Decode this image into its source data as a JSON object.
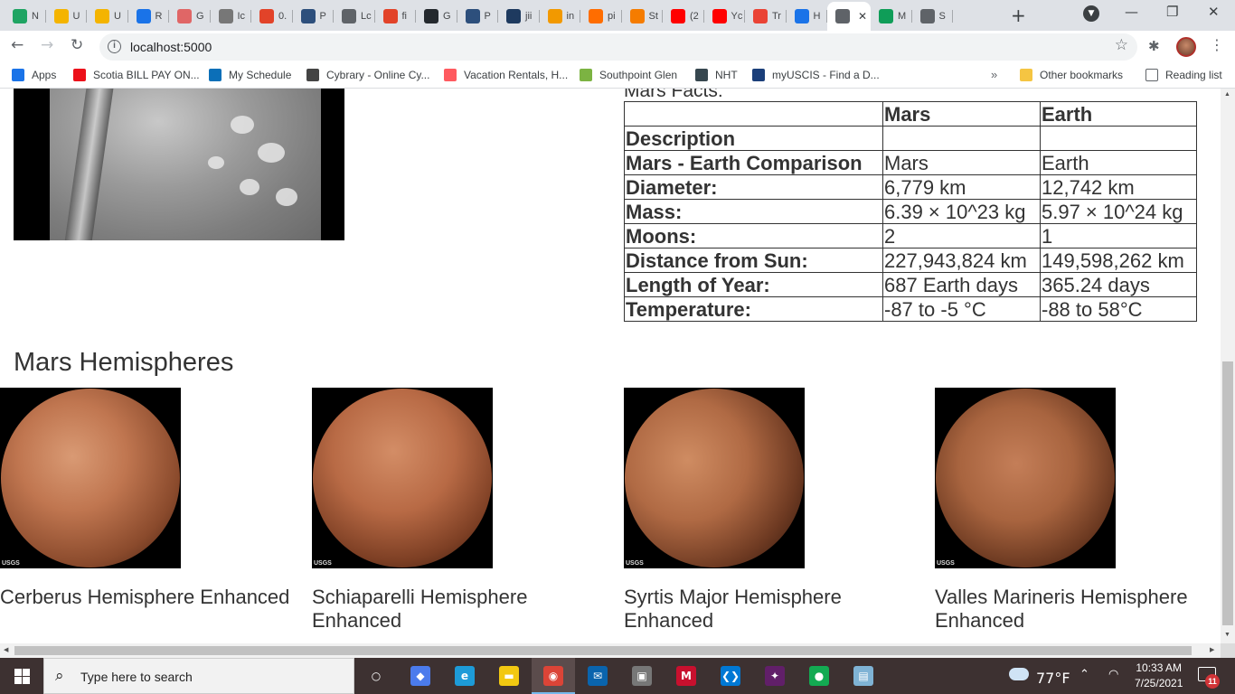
{
  "browser": {
    "tabs": [
      {
        "label": "N",
        "icon": "google-drive-icon",
        "color": "#1fa463"
      },
      {
        "label": "U",
        "icon": "slides-icon",
        "color": "#f4b400"
      },
      {
        "label": "U",
        "icon": "slides-icon",
        "color": "#f4b400"
      },
      {
        "label": "R",
        "icon": "video-icon",
        "color": "#1a73e8"
      },
      {
        "label": "G",
        "icon": "network-icon",
        "color": "#e06666"
      },
      {
        "label": "Ic",
        "icon": "doc-icon",
        "color": "#777777"
      },
      {
        "label": "0.",
        "icon": "gitlab-icon",
        "color": "#e24329"
      },
      {
        "label": "P",
        "icon": "tds-icon",
        "color": "#2d4f7c"
      },
      {
        "label": "Lc",
        "icon": "globe-icon",
        "color": "#5f6368"
      },
      {
        "label": "fi",
        "icon": "gitlab-icon",
        "color": "#e24329"
      },
      {
        "label": "G",
        "icon": "github-icon",
        "color": "#24292e"
      },
      {
        "label": "P",
        "icon": "tds-icon",
        "color": "#2d4f7c"
      },
      {
        "label": "jii",
        "icon": "terminal-icon",
        "color": "#1e3a5f"
      },
      {
        "label": "in",
        "icon": "chart-icon",
        "color": "#f29900"
      },
      {
        "label": "pi",
        "icon": "codepen-icon",
        "color": "#ff6d00"
      },
      {
        "label": "St",
        "icon": "book-icon",
        "color": "#f57c00"
      },
      {
        "label": "(2",
        "icon": "youtube-icon",
        "color": "#ff0000"
      },
      {
        "label": "Yc",
        "icon": "youtube-icon",
        "color": "#ff0000"
      },
      {
        "label": "Tr",
        "icon": "gmail-icon",
        "color": "#ea4335"
      },
      {
        "label": "H",
        "icon": "info-icon",
        "color": "#1a73e8"
      },
      {
        "label": "",
        "icon": "globe-icon",
        "color": "#5f6368",
        "active": true
      },
      {
        "label": "M",
        "icon": "plus-tile-icon",
        "color": "#0f9d58"
      },
      {
        "label": "S",
        "icon": "globe-icon",
        "color": "#5f6368"
      }
    ],
    "new_tab_glyph": "+",
    "url": "localhost:5000",
    "bookmarks": [
      {
        "label": "Apps",
        "icon": "apps-grid-icon",
        "color": "#1a73e8"
      },
      {
        "label": "Scotia BILL PAY ON...",
        "icon": "scotia-icon",
        "color": "#ec111a"
      },
      {
        "label": "My Schedule",
        "icon": "schedule-icon",
        "color": "#0b6fb8"
      },
      {
        "label": "Cybrary - Online Cy...",
        "icon": "cybrary-icon",
        "color": "#444444"
      },
      {
        "label": "Vacation Rentals, H...",
        "icon": "airbnb-icon",
        "color": "#ff5a5f"
      },
      {
        "label": "Southpoint Glen",
        "icon": "building-icon",
        "color": "#7cb342"
      },
      {
        "label": "NHT",
        "icon": "nht-icon",
        "color": "#37474f"
      },
      {
        "label": "myUSCIS - Find a D...",
        "icon": "uscis-icon",
        "color": "#1b3f7a"
      }
    ],
    "more_bookmarks_glyph": "»",
    "other_bookmarks": "Other bookmarks",
    "reading_list": "Reading list"
  },
  "page": {
    "facts_heading": "Mars Facts:",
    "table": {
      "headers": [
        "",
        "Mars",
        "Earth"
      ],
      "rows": [
        [
          "Description",
          "",
          ""
        ],
        [
          "Mars - Earth Comparison",
          "Mars",
          "Earth"
        ],
        [
          "Diameter:",
          "6,779 km",
          "12,742 km"
        ],
        [
          "Mass:",
          "6.39 × 10^23 kg",
          "5.97 × 10^24 kg"
        ],
        [
          "Moons:",
          "2",
          "1"
        ],
        [
          "Distance from Sun:",
          "227,943,824 km",
          "149,598,262 km"
        ],
        [
          "Length of Year:",
          "687 Earth days",
          "365.24 days"
        ],
        [
          "Temperature:",
          "-87 to -5 °C",
          "-88 to 58°C"
        ]
      ]
    },
    "hemispheres_heading": "Mars Hemispheres",
    "hemispheres": [
      {
        "title": "Cerberus Hemisphere Enhanced",
        "watermark": "USGS"
      },
      {
        "title": "Schiaparelli Hemisphere Enhanced",
        "watermark": "USGS"
      },
      {
        "title": "Syrtis Major Hemisphere Enhanced",
        "watermark": "USGS"
      },
      {
        "title": "Valles Marineris Hemisphere Enhanced",
        "watermark": "USGS"
      }
    ]
  },
  "taskbar": {
    "search_placeholder": "Type here to search",
    "apps": [
      {
        "icon": "task-view-icon",
        "color": "#3d3131"
      },
      {
        "icon": "git-icon",
        "color": "#4b7bec"
      },
      {
        "icon": "edge-icon",
        "color": "#1d9bd8"
      },
      {
        "icon": "file-explorer-icon",
        "color": "#f2c811"
      },
      {
        "icon": "chrome-icon",
        "color": "#db4437",
        "active": true
      },
      {
        "icon": "mail-icon",
        "color": "#0a64ad"
      },
      {
        "icon": "store-icon",
        "color": "#777777"
      },
      {
        "icon": "mcafee-icon",
        "color": "#c8102e"
      },
      {
        "icon": "vscode-icon",
        "color": "#0078d4"
      },
      {
        "icon": "slack-icon",
        "color": "#611f69"
      },
      {
        "icon": "mongodb-icon",
        "color": "#13aa52"
      },
      {
        "icon": "notepad-icon",
        "color": "#7fb3d5"
      }
    ],
    "weather": "77°F",
    "time": "10:33 AM",
    "date": "7/25/2021",
    "notification_count": "11"
  }
}
